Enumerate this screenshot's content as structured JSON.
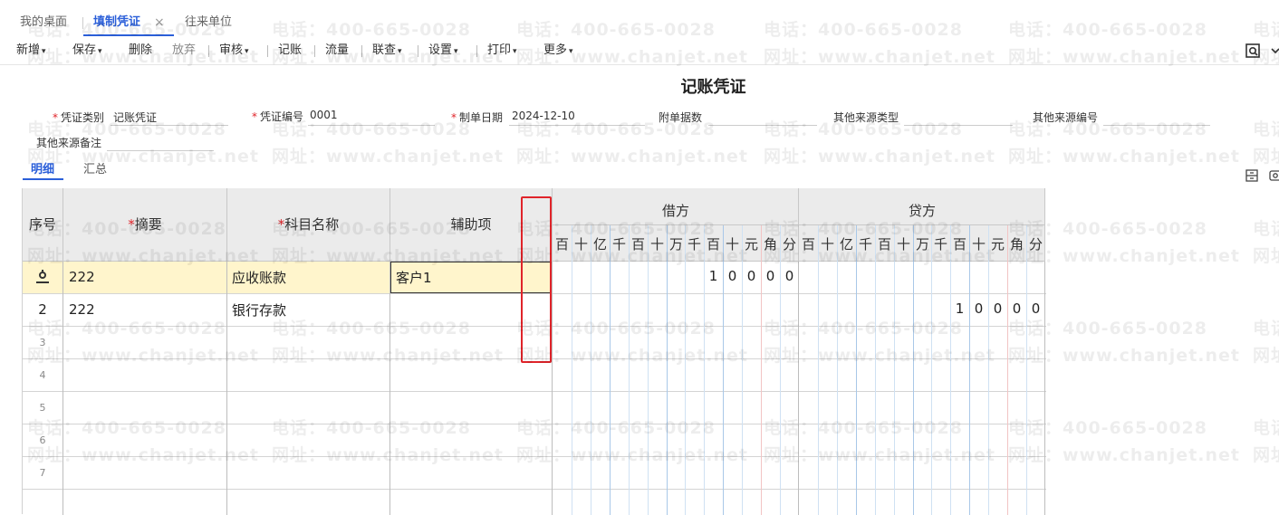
{
  "tabs": [
    {
      "label": "我的桌面"
    },
    {
      "label": "填制凭证"
    },
    {
      "label": "往来单位"
    }
  ],
  "toolbar": {
    "new": "新增",
    "save": "保存",
    "delete": "删除",
    "discard": "放弃",
    "audit": "审核",
    "post": "记账",
    "flow": "流量",
    "link": "联查",
    "settings": "设置",
    "print": "打印",
    "more": "更多"
  },
  "form": {
    "title": "记账凭证",
    "voucher_type_label": "凭证类别",
    "voucher_type_value": "记账凭证",
    "voucher_no_label": "凭证编号",
    "voucher_no_value": "0001",
    "date_label": "制单日期",
    "date_value": "2024-12-10",
    "attachments_label": "附单据数",
    "source_type_label": "其他来源类型",
    "source_no_label": "其他来源编号",
    "source_note_label": "其他来源备注"
  },
  "subtabs": [
    "明细",
    "汇总"
  ],
  "grid": {
    "headers": {
      "seq": "序号",
      "summary": "摘要",
      "account": "科目名称",
      "aux": "辅助项",
      "debit": "借方",
      "credit": "贷方"
    },
    "digit_headers": [
      "百",
      "十",
      "亿",
      "千",
      "百",
      "十",
      "万",
      "千",
      "百",
      "十",
      "元",
      "角",
      "分"
    ],
    "rows": [
      {
        "seq": "",
        "summary": "222",
        "account": "应收账款",
        "aux": "客户1",
        "debit": "10000",
        "credit": ""
      },
      {
        "seq": "2",
        "summary": "222",
        "account": "银行存款",
        "aux": "",
        "debit": "",
        "credit": "10000"
      },
      {
        "seq": "3",
        "summary": "",
        "account": "",
        "aux": "",
        "debit": "",
        "credit": ""
      },
      {
        "seq": "4",
        "summary": "",
        "account": "",
        "aux": "",
        "debit": "",
        "credit": ""
      },
      {
        "seq": "5",
        "summary": "",
        "account": "",
        "aux": "",
        "debit": "",
        "credit": ""
      },
      {
        "seq": "6",
        "summary": "",
        "account": "",
        "aux": "",
        "debit": "",
        "credit": ""
      },
      {
        "seq": "7",
        "summary": "",
        "account": "",
        "aux": "",
        "debit": "",
        "credit": ""
      }
    ]
  },
  "watermark": {
    "phone": "电话：400-665-0028",
    "site": "网址：www.chanjet.net"
  },
  "colors": {
    "accent": "#2b5fd9",
    "required": "#e0242a",
    "selected_row": "#fff5cc",
    "highlight_box": "#e0242a"
  }
}
